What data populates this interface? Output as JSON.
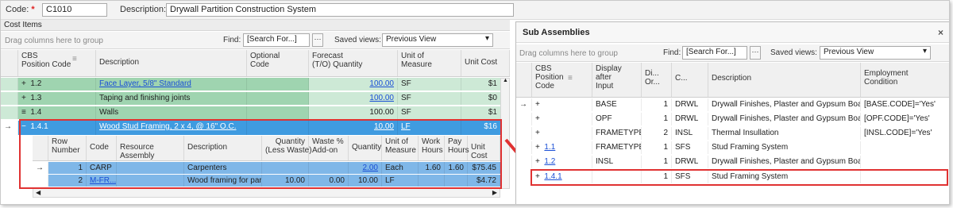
{
  "top": {
    "code_label": "Code:",
    "code_value": "C1010",
    "desc_label": "Description:",
    "desc_value": "Drywall Partition Construction System"
  },
  "cost_items": {
    "title": "Cost Items",
    "group_placeholder": "Drag columns here to group",
    "find_label": "Find:",
    "find_value": "[Search For...]",
    "views_label": "Saved views:",
    "views_value": "Previous View",
    "columns": {
      "cbs": "CBS\nPosition Code",
      "desc": "Description",
      "optcode": "Optional\nCode",
      "qty": "Forecast\n(T/O) Quantity",
      "uom": "Unit of\nMeasure",
      "ucost": "Unit Cost"
    },
    "rows": [
      {
        "expand": "+",
        "cbs": "1.2",
        "desc": "Face Layer, 5/8\" Standard",
        "qty": "100.00",
        "uom": "SF",
        "ucost": "$1"
      },
      {
        "expand": "+",
        "cbs": "1.3",
        "desc": "Taping and finishing joints",
        "qty": "100.00",
        "uom": "SF",
        "ucost": "$0"
      },
      {
        "expand": "≡",
        "cbs": "1.4",
        "desc": "Walls",
        "qty": "100.00",
        "uom": "SF",
        "ucost": "$1"
      },
      {
        "expand": "−",
        "cbs": "1.4.1",
        "desc": "Wood Stud Framing, 2 x 4, @ 16\" O.C.",
        "qty": "10.00",
        "uom": "LF",
        "ucost": "$16"
      }
    ],
    "sub_columns": {
      "rownum": "Row\nNumber",
      "code": "Code",
      "resasm": "Resource Assembly",
      "desc": "Description",
      "qty_less": "Quantity\n(Less Waste)",
      "waste": "Waste %\nAdd-on",
      "qty": "Quantity",
      "uom": "Unit of\nMeasure",
      "work": "Work\nHours",
      "pay": "Pay\nHours",
      "ucost": "Unit Cost"
    },
    "sub_rows": [
      {
        "rownum": "1",
        "code": "CARP",
        "resasm": "",
        "desc": "Carpenters",
        "qty_less": "",
        "waste": "",
        "qty": "2.00",
        "uom": "Each",
        "work": "1.60",
        "pay": "1.60",
        "ucost": "$75.45"
      },
      {
        "rownum": "2",
        "code": "M-FR...",
        "resasm": "",
        "desc": "Wood framing for par...",
        "qty_less": "10.00",
        "waste": "0.00",
        "qty": "10.00",
        "uom": "LF",
        "work": "",
        "pay": "",
        "ucost": "$4.72"
      }
    ]
  },
  "sub_assemblies": {
    "title": "Sub Assemblies",
    "close": "×",
    "group_placeholder": "Drag columns here to group",
    "find_label": "Find:",
    "find_value": "[Search For...]",
    "views_label": "Saved views:",
    "views_value": "Previous View",
    "columns": {
      "cbs": "CBS\nPosition\nCode",
      "display": "Display\nafter\nInput",
      "di": "Di...\nOr...",
      "c": "C...",
      "desc": "Description",
      "emp": "Employment\nCondition"
    },
    "rows": [
      {
        "cbs": "+",
        "display": "BASE",
        "di": "1",
        "c": "DRWL",
        "desc": "Drywall Finishes, Plaster and Gypsum Board",
        "emp": "[BASE.CODE]='Yes'"
      },
      {
        "cbs": "+",
        "display": "OPF",
        "di": "1",
        "c": "DRWL",
        "desc": "Drywall Finishes, Plaster and Gypsum Board",
        "emp": "[OPF.CODE]='Yes'"
      },
      {
        "cbs": "+",
        "display": "FRAMETYPE",
        "di": "2",
        "c": "INSL",
        "desc": "Thermal Insullation",
        "emp": "[INSL.CODE]='Yes'"
      },
      {
        "cbs": "1.1",
        "display": "FRAMETYPE",
        "di": "1",
        "c": "SFS",
        "desc": "Stud Framing System",
        "emp": ""
      },
      {
        "cbs": "1.2",
        "display": "INSL",
        "di": "1",
        "c": "DRWL",
        "desc": "Drywall Finishes, Plaster and Gypsum Board",
        "emp": ""
      },
      {
        "cbs": "1.4.1",
        "display": "",
        "di": "1",
        "c": "SFS",
        "desc": "Stud Framing System",
        "emp": ""
      }
    ]
  },
  "colors": {
    "highlight": "#e03232",
    "selected": "#3f9be0",
    "group": "#9fd4b0"
  }
}
